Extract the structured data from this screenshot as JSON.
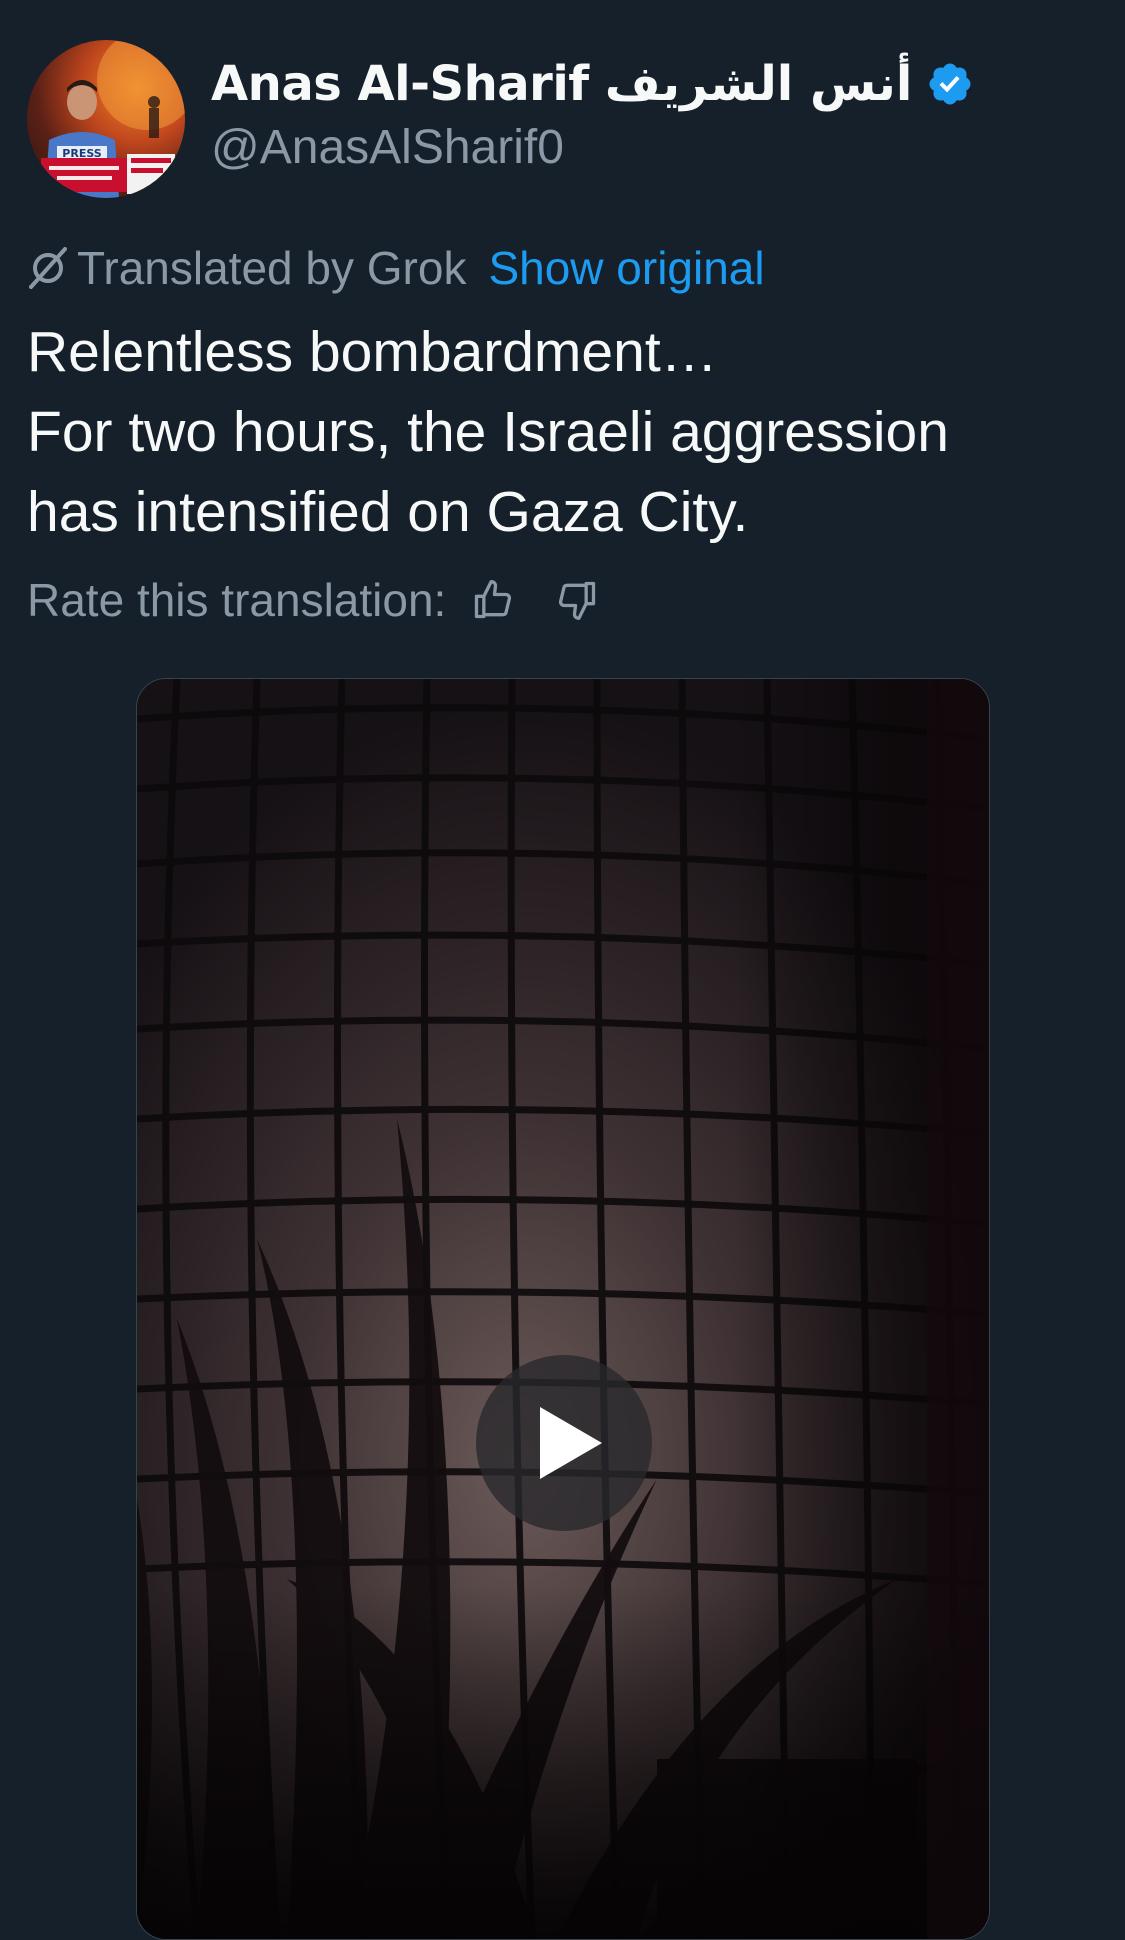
{
  "author": {
    "display_name": "Anas Al-Sharif أنس الشريف",
    "handle": "@AnasAlSharif0",
    "verified": true,
    "verified_icon": "verified-badge-icon",
    "accent_color": "#1d9bf0",
    "avatar_badge_text": "PRESS"
  },
  "translation": {
    "icon": "grok-icon",
    "label": "Translated by Grok",
    "show_original": "Show original"
  },
  "tweet": {
    "lines": [
      "Relentless bombardment…",
      "For two hours, the Israeli aggression",
      "has intensified on Gaza City."
    ]
  },
  "rating": {
    "label": "Rate this translation:",
    "thumbs_up_icon": "thumbs-up-icon",
    "thumbs_down_icon": "thumbs-down-icon"
  },
  "media": {
    "type": "video",
    "play_icon": "play-icon"
  },
  "colors": {
    "background": "#15202b",
    "text_primary": "#f7f9f9",
    "text_secondary": "#8b98a5",
    "link": "#1d9bf0"
  }
}
